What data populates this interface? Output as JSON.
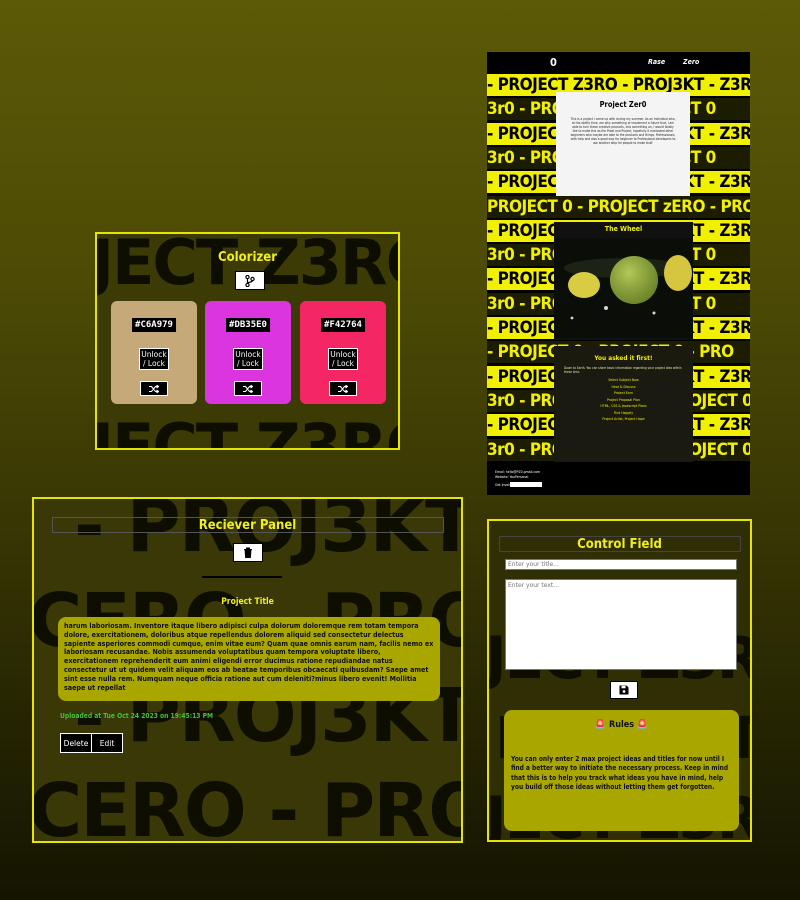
{
  "colorizer": {
    "bg_text_top": "JECT Z3RO",
    "bg_text_bottom": "JECT Z3RO",
    "title": "Colorizer",
    "branch_icon": "code-branch-icon",
    "cards": [
      {
        "hex": "#C6A979",
        "color": "#c6a979",
        "unlock": "Unlock / Lock"
      },
      {
        "hex": "#DB35E0",
        "color": "#db35e0",
        "unlock": "Unlock / Lock"
      },
      {
        "hex": "#F42764",
        "color": "#f42764",
        "unlock": "Unlock / Lock"
      }
    ],
    "shuffle_icon": "shuffle-icon"
  },
  "site": {
    "logo": "0",
    "nav_left": "Rase",
    "nav_right": "Zero",
    "stripes": [
      "- PROJECT Z3RO - PROJ3KT - Z3RO",
      "3r0 - PROJECT 0 - PROJECT 0",
      "- PROJECT Z3RO - PROJ3KT - Z3RO",
      "3r0 - PROJECT 0 - PROJECT 0",
      "- PROJECT Z3RO - PROJ3KT - Z3RO",
      "PROJECT 0 - PROJECT zERO - PRO",
      "- PROJECT Z3RO - PROJ3KT - Z3RO",
      "3r0 - PROJECT 0 - PROJECT 0",
      "- PROJECT Z3RO - PROJ3KT - Z3RO",
      "3r0 - PROJECT 0 - PROJECT 0",
      "- PROJECT Z3RO - PROJ3KT - Z3RO",
      "- PROJECT 0 - PROJECT 0 - PRO",
      "- PROJECT Z3RO - PROJ3KT - Z3RO",
      "3r0 - PROj3C+ CERO - PROJECT 0",
      "- PROJECT Z3RO - PROJ3KT - Z3RO",
      "3r0 - PROj3C+ CERO - PROJECT 0"
    ],
    "intro_title": "Project Zer0",
    "intro_body": "This is a project I came up with during my summer. As an individual who, at the ability time, are why something or implement a future that, I am able to turn these creative products, into something an, I would totally like to make this as the Proof and Project, hopefully it motivated other beginners who maybe are able to the products and things. Professionals, with help and also a good way for beginner to Professional developers to use another step for people to make stuff.",
    "wheel_title": "The Wheel",
    "faq_title": "You asked it first!",
    "faq_intro": "Down to Earth. You can share basic information regarding your project idea within these links",
    "faq_links": [
      "Select Subject Now",
      "Hear & Discuss",
      "Project Earn",
      "Project Proposal Plan",
      "HTML, CSS & Javascript Plans",
      "Find Happily",
      "Project Artist, Project Hope"
    ],
    "footer_email": "Email: hello@PZ0.gmail.com",
    "footer_made": "Website: YouPersonal",
    "footer_input_label": "Get Involved"
  },
  "receiver": {
    "bg_lines": [
      "- PROJ3KT - Z3",
      "CERO - PROJEC",
      "- PROJ3KT - Z3",
      "CERO - PROJEC"
    ],
    "title": "Reciever Panel",
    "trash_icon": "trash-icon",
    "project_title": "Project Title",
    "body": "harum laboriosam. Inventore itaque libero adipisci culpa dolorum doloremque rem totam tempora dolore, exercitationem, doloribus atque repellendus dolorem aliquid sed consectetur delectus sapiente asperiores commodi cumque, enim vitae eum? Quam quae omnis earum nam, facilis nemo ex laboriosam recusandae. Nobis assumenda voluptatibus quam tempora voluptate libero, exercitationem reprehenderit eum animi eligendi error ducimus ratione repudiandae natus consectetur ut ut quidem velit aliquam eos ab beatae temporibus obcaecati quibusdam? Saepe amet sint esse nulla rem. Numquam neque officia ratione aut cum deleniti?minus libero evenit! Mollitia saepe ut repellat",
    "uploaded": "Uploaded at Tue Oct 24 2023 on 19:45:13 PM",
    "delete_label": "Delete",
    "edit_label": "Edit"
  },
  "control": {
    "bg_lines": [
      "JECT Z3RO",
      "PROJECT",
      "JECT Z3RO"
    ],
    "title": "Control Field",
    "title_placeholder": "Enter your title...",
    "text_placeholder": "Enter your text...",
    "save_icon": "floppy-disk-icon",
    "rules_icon": "siren-icon",
    "rules_title": "Rules",
    "rules_body": "You can only enter 2 max project ideas and titles for now until I find a better way to initiate the necessary process. Keep in mind that this is to help you track what ideas you have in mind, help you build off those ideas without letting them get forgotten."
  }
}
